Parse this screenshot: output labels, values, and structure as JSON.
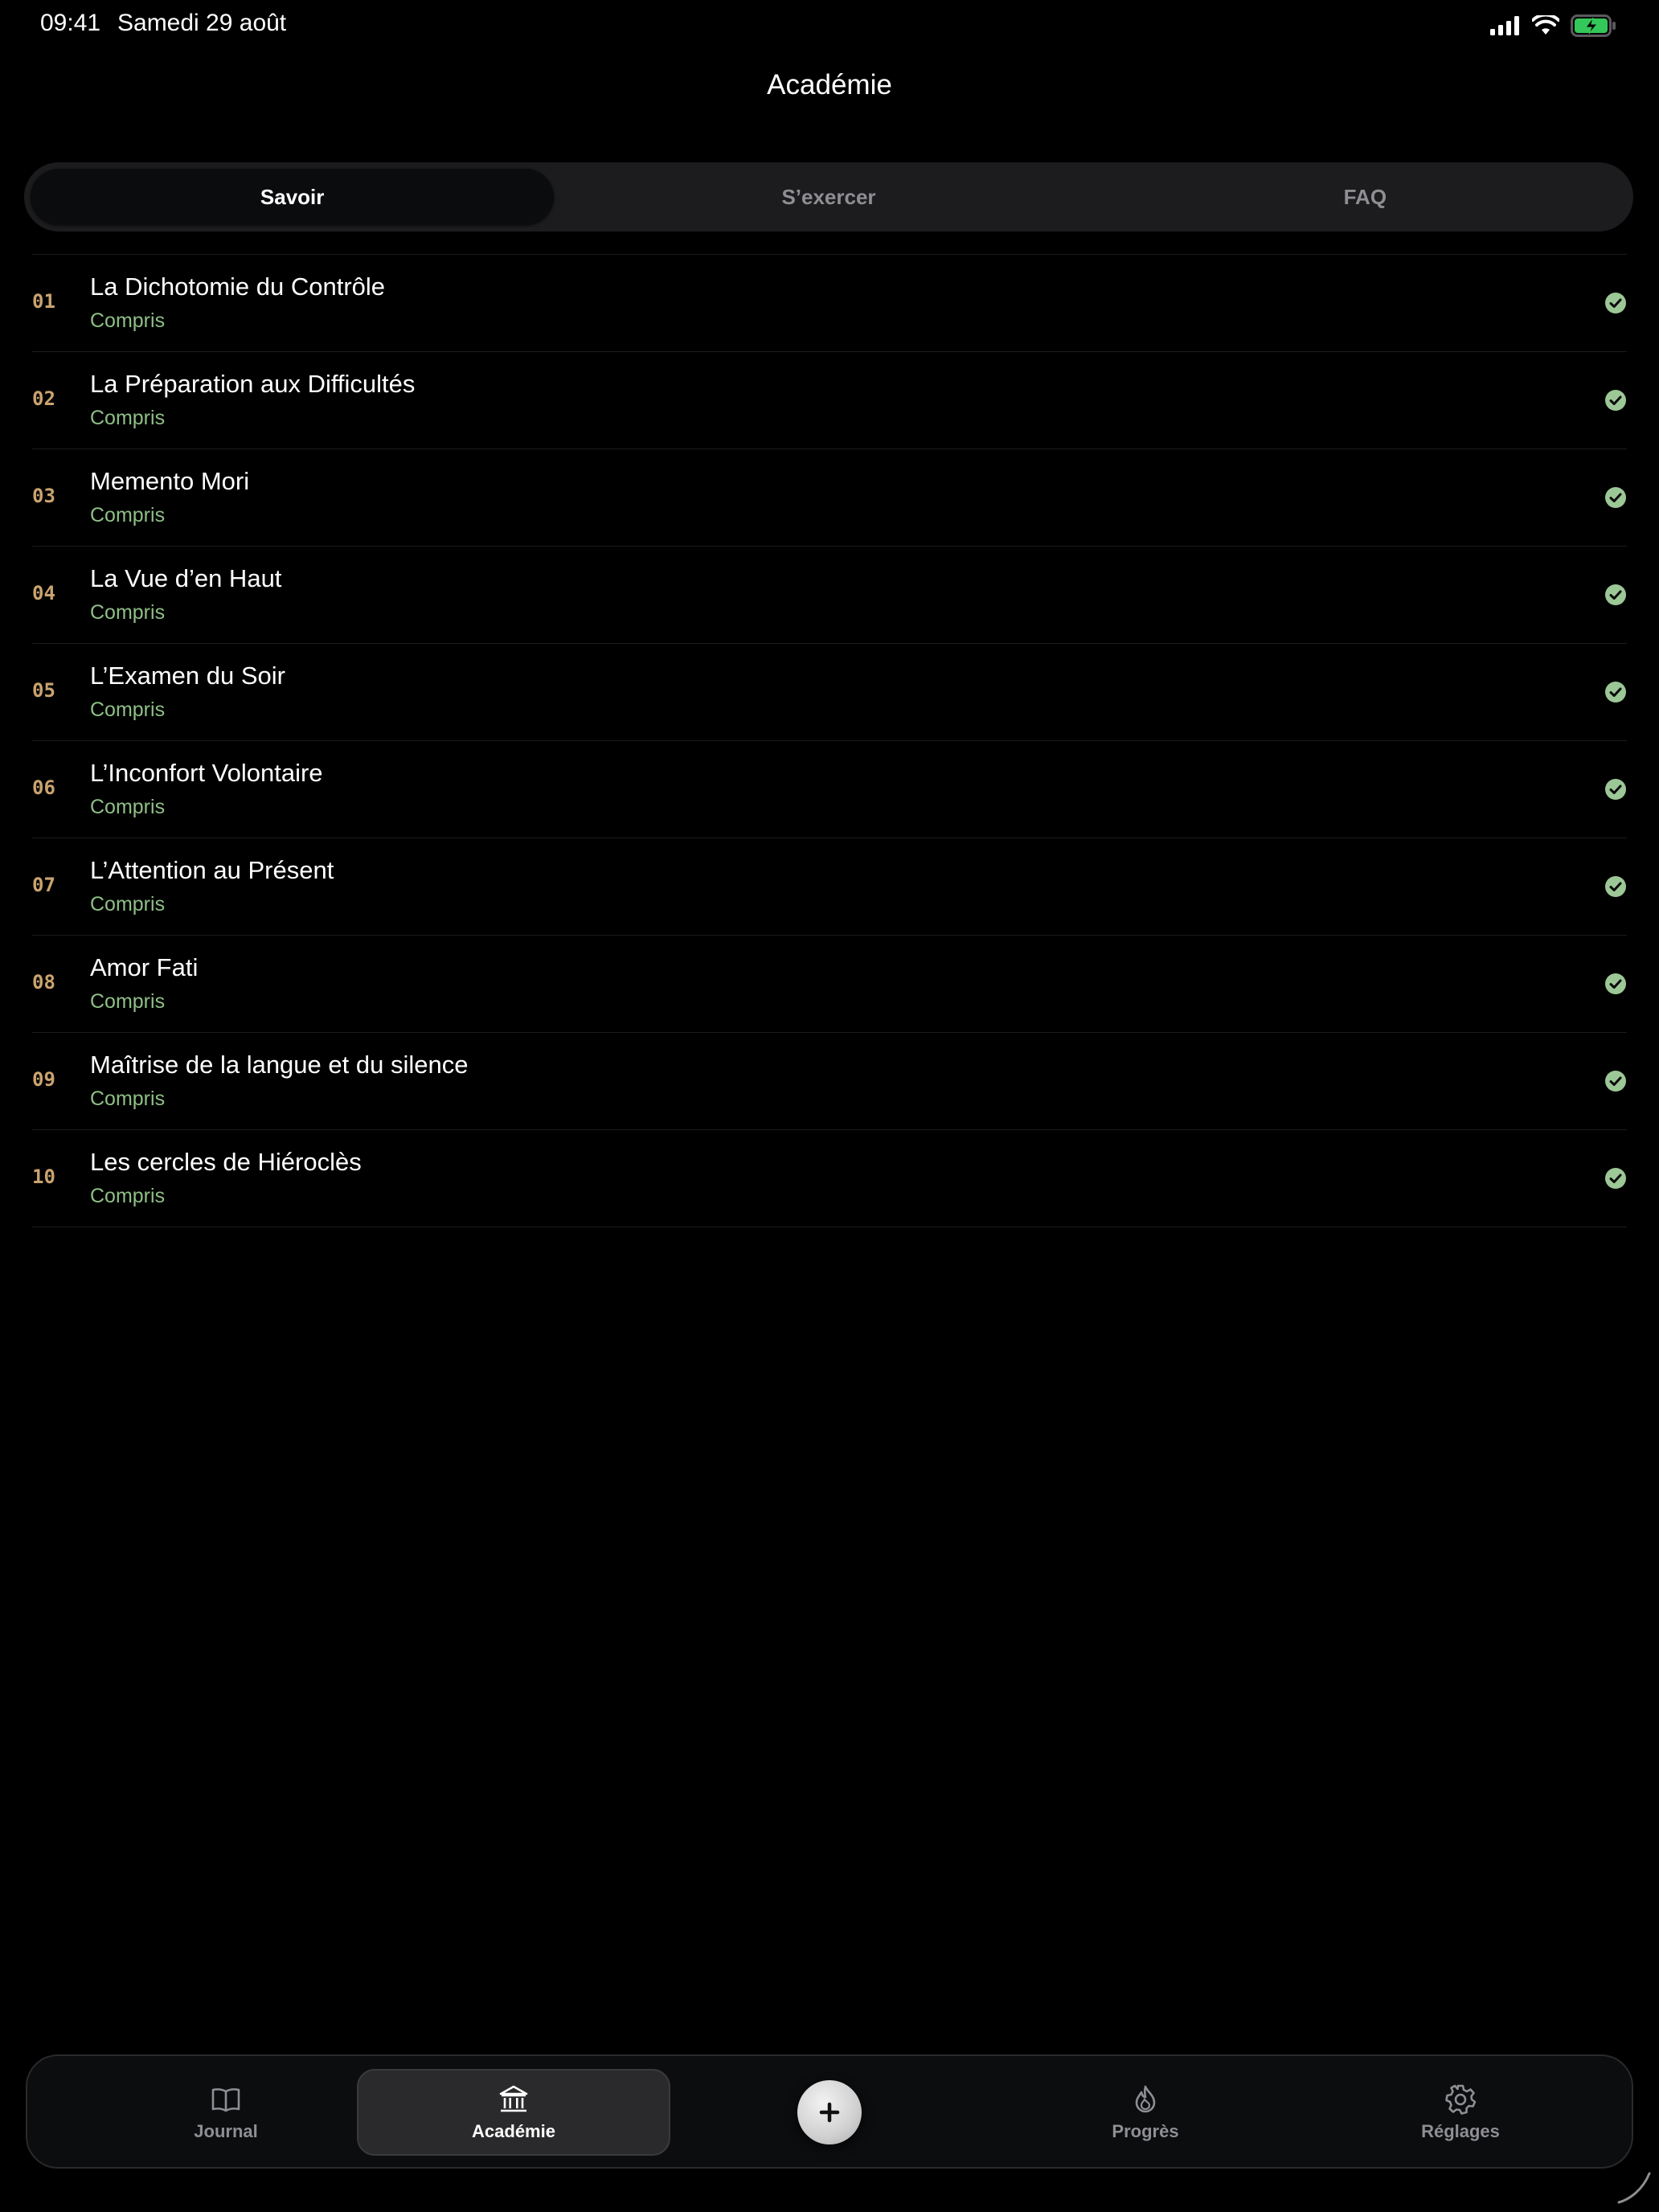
{
  "status_bar": {
    "time": "09:41",
    "date": "Samedi 29 août"
  },
  "header": {
    "title": "Académie"
  },
  "segments": [
    {
      "label": "Savoir",
      "active": true
    },
    {
      "label": "S’exercer",
      "active": false
    },
    {
      "label": "FAQ",
      "active": false
    }
  ],
  "lessons": [
    {
      "number": "01",
      "title": "La Dichotomie du Contrôle",
      "status": "Compris"
    },
    {
      "number": "02",
      "title": "La Préparation aux Difficultés",
      "status": "Compris"
    },
    {
      "number": "03",
      "title": "Memento Mori",
      "status": "Compris"
    },
    {
      "number": "04",
      "title": "La Vue d’en Haut",
      "status": "Compris"
    },
    {
      "number": "05",
      "title": "L’Examen du Soir",
      "status": "Compris"
    },
    {
      "number": "06",
      "title": "L’Inconfort Volontaire",
      "status": "Compris"
    },
    {
      "number": "07",
      "title": "L’Attention au Présent",
      "status": "Compris"
    },
    {
      "number": "08",
      "title": "Amor Fati",
      "status": "Compris"
    },
    {
      "number": "09",
      "title": "Maîtrise de la langue et du silence",
      "status": "Compris"
    },
    {
      "number": "10",
      "title": "Les cercles de Hiéroclès",
      "status": "Compris"
    }
  ],
  "tab_bar": {
    "items": [
      {
        "label": "Journal",
        "icon": "book-icon",
        "active": false
      },
      {
        "label": "Académie",
        "icon": "institution-icon",
        "active": true
      },
      {
        "label": "Progrès",
        "icon": "flame-icon",
        "active": false
      },
      {
        "label": "Réglages",
        "icon": "gear-icon",
        "active": false
      }
    ],
    "add_icon": "plus-icon"
  },
  "colors": {
    "background": "#000000",
    "accent_number": "#c9a36f",
    "status_green": "#8fbf86",
    "check_fill": "#9cc796",
    "battery_green": "#34c759"
  }
}
